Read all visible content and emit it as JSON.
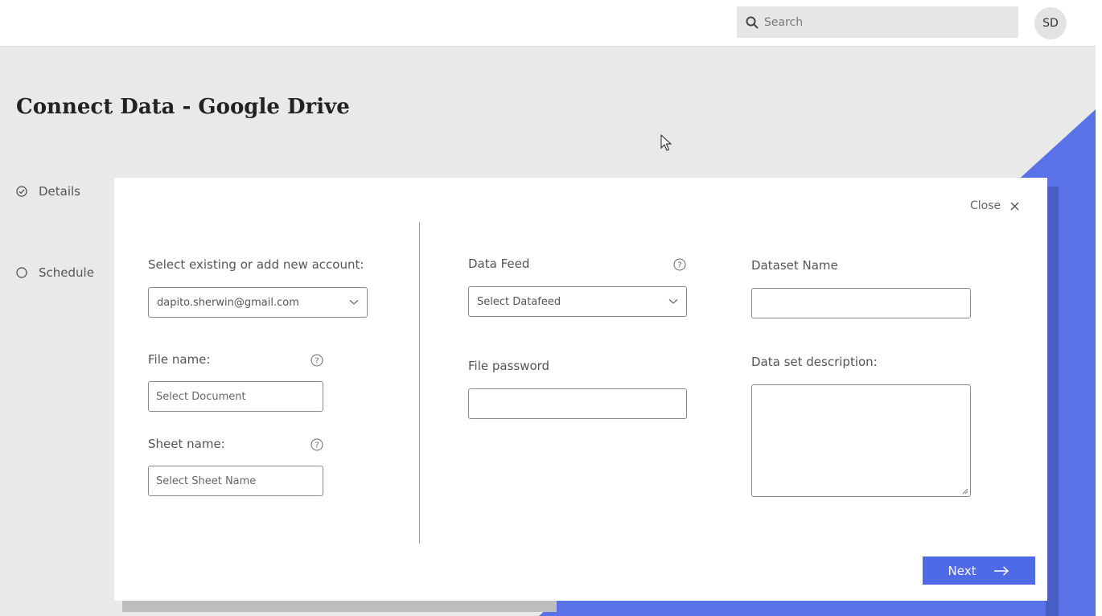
{
  "header": {
    "search_placeholder": "Search",
    "avatar_initials": "SD"
  },
  "page": {
    "title": "Connect Data - Google Drive"
  },
  "steps": [
    {
      "label": "Details",
      "state": "completed"
    },
    {
      "label": "Schedule",
      "state": "pending"
    }
  ],
  "modal": {
    "close_label": "Close",
    "account": {
      "label": "Select existing or add new account:",
      "selected": "dapito.sherwin@gmail.com"
    },
    "file_name": {
      "label": "File name:",
      "placeholder": "Select Document"
    },
    "sheet_name": {
      "label": "Sheet name:",
      "placeholder": "Select Sheet Name"
    },
    "data_feed": {
      "label": "Data Feed",
      "selected": "Select Datafeed"
    },
    "file_password": {
      "label": "File password",
      "value": ""
    },
    "dataset_name": {
      "label": "Dataset Name",
      "value": ""
    },
    "dataset_description": {
      "label": "Data set description:",
      "value": ""
    },
    "next_label": "Next"
  },
  "colors": {
    "accent": "#4f6ae6",
    "accent_dark": "#4a5fc4",
    "background": "#e9e9e9"
  }
}
